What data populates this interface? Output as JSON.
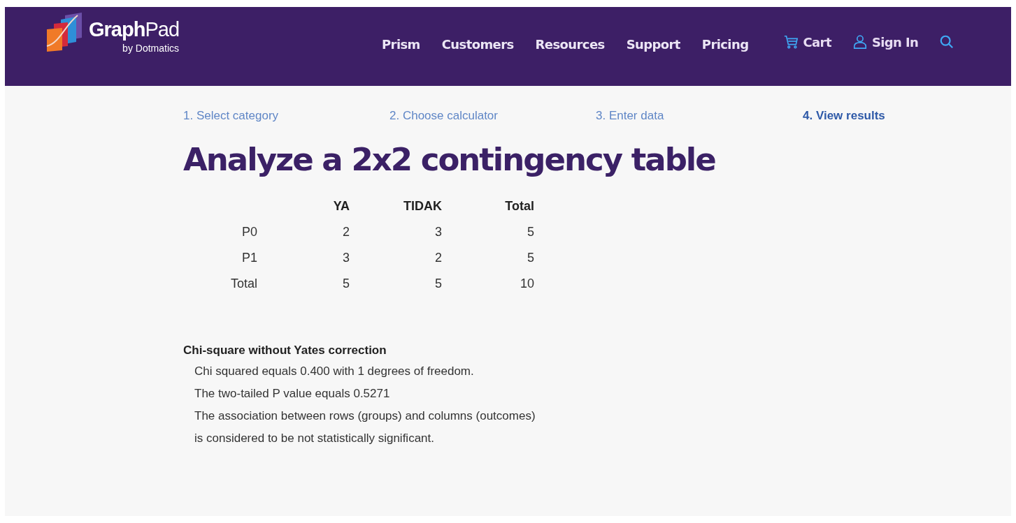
{
  "header": {
    "logo": {
      "name": "**Graph**Pad",
      "byline": "by Dotmatics"
    },
    "nav": [
      {
        "label": "Prism"
      },
      {
        "label": "Customers"
      },
      {
        "label": "Resources"
      },
      {
        "label": "Support"
      },
      {
        "label": "Pricing"
      }
    ],
    "actions": [
      {
        "kind": "cart",
        "label": "Cart"
      },
      {
        "kind": "user",
        "label": "Sign In"
      },
      {
        "kind": "search"
      }
    ]
  },
  "steps": [
    {
      "label": "1. Select category",
      "selected": false
    },
    {
      "label": "2. Choose calculator",
      "selected": false
    },
    {
      "label": "3. Enter data",
      "selected": false
    },
    {
      "label": "4. View results",
      "selected": true
    }
  ],
  "title": "Analyze a 2x2 contingency table",
  "table": {
    "columns": [
      "YA",
      "TIDAK",
      "Total"
    ],
    "rows": [
      {
        "label": "P0",
        "cells": [
          "2",
          "3",
          "5"
        ]
      },
      {
        "label": "P1",
        "cells": [
          "3",
          "2",
          "5"
        ]
      },
      {
        "label": "Total",
        "cells": [
          "5",
          "5",
          "10"
        ]
      }
    ]
  },
  "results": {
    "heading": "Chi-square without Yates correction",
    "lines": [
      "Chi squared equals 0.400 with 1 degrees of freedom.",
      "The two-tailed P value equals 0.5271",
      "The association between rows (groups) and columns (outcomes)",
      "is considered to be not statistically significant."
    ]
  }
}
